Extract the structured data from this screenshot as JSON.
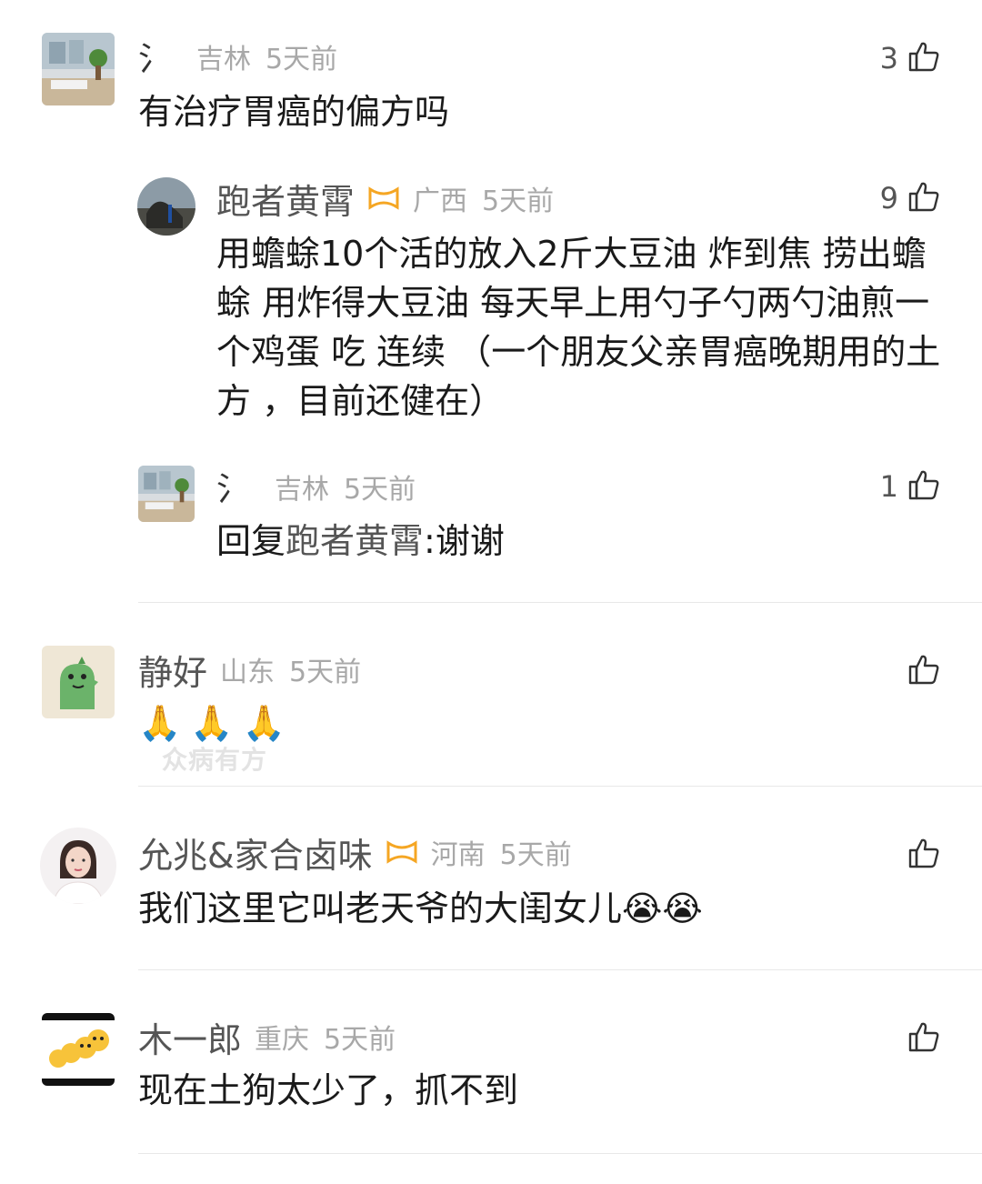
{
  "comments": [
    {
      "username": "氵",
      "location": "吉林",
      "time": "5天前",
      "likes": "3",
      "text": "有治疗胃癌的偏方吗"
    },
    {
      "username": "跑者黄霄",
      "location": "广西",
      "time": "5天前",
      "likes": "9",
      "text": "用蟾蜍10个活的放入2斤大豆油 炸到焦 捞出蟾蜍 用炸得大豆油 每天早上用勺子勺两勺油煎一个鸡蛋 吃 连续 （一个朋友父亲胃癌晚期用的土方 ，目前还健在）"
    },
    {
      "username": "氵",
      "location": "吉林",
      "time": "5天前",
      "likes": "1",
      "reply_prefix": "回复",
      "reply_to": "跑者黄霄",
      "reply_text": ":谢谢"
    },
    {
      "username": "静好",
      "location": "山东",
      "time": "5天前",
      "likes": "",
      "emojis": [
        "🙏",
        "🙏",
        "🙏"
      ]
    },
    {
      "username": "允兆&家合卤味",
      "location": "河南",
      "time": "5天前",
      "likes": "",
      "text": "我们这里它叫老天爷的大闺女儿",
      "emojis": [
        "😭",
        "😭"
      ]
    },
    {
      "username": "木一郎",
      "location": "重庆",
      "time": "5天前",
      "likes": "",
      "text": "现在土狗太少了，抓不到"
    }
  ],
  "watermark": "众病有方",
  "colors": {
    "badge": "#f5a623",
    "meta": "#a8a8a8",
    "divider": "#e8e8e8"
  },
  "icons": {
    "like": "thumbs-up-icon",
    "badge": "infinity-badge-icon"
  }
}
